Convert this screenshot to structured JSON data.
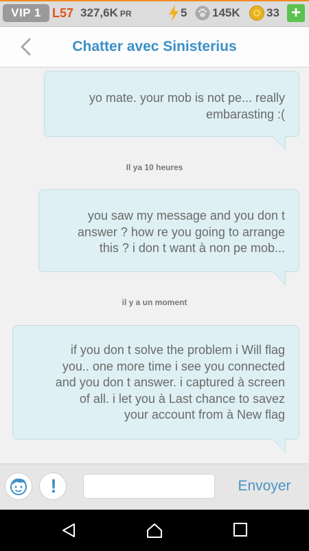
{
  "status": {
    "vip": "VIP 1",
    "level": "L57",
    "pr_value": "327,6K",
    "pr_unit": "PR",
    "energy": "5",
    "paws": "145K",
    "coins": "33",
    "plus": "+"
  },
  "header": {
    "title": "Chatter avec Sinisterius"
  },
  "messages": [
    {
      "lines": [
        "yo mate.  your mob is not pe...  really",
        "embarasting :("
      ]
    },
    {
      "lines": [
        "you saw my message and you don t",
        "answer ? how re you going to arrange",
        "this ? i don t want à non pe mob..."
      ]
    },
    {
      "lines": [
        "if you don t solve the problem i Will flag",
        "you..  one more time i see you connected",
        "and you don t answer. i captured à screen",
        "of all.  i let you à Last chance to savez",
        "your account from à New flag"
      ]
    }
  ],
  "timestamps": [
    "Il ya 10 heures",
    "il y a un moment"
  ],
  "input": {
    "value": "",
    "placeholder": ""
  },
  "send_label": "Envoyer",
  "icons": [
    "back-icon",
    "bolt-icon",
    "paw-icon",
    "coin-icon",
    "avatar-icon",
    "report-icon",
    "nav-back-icon",
    "nav-home-icon",
    "nav-recents-icon"
  ],
  "colors": {
    "accent": "#3b8fc6",
    "bubble": "#def0f3",
    "level": "#e2531d",
    "plus": "#5cc151"
  }
}
